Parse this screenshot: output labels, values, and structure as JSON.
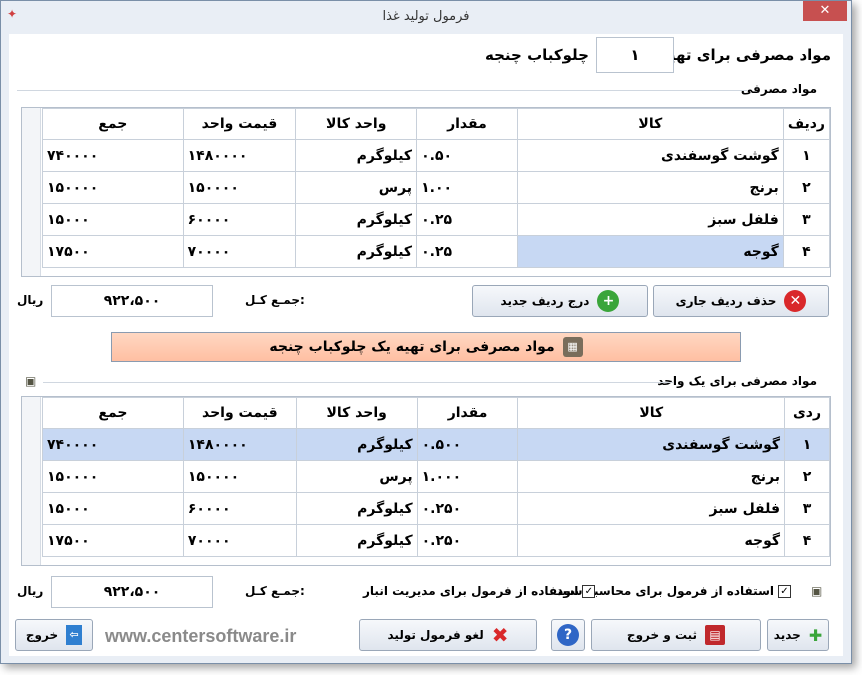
{
  "window": {
    "title": "فرمول تولید غذا",
    "close_label": "✕"
  },
  "header": {
    "label": "مواد مصرفی برای تهیه",
    "quantity": "۱",
    "product": "چلوکباب چنجه"
  },
  "section1": {
    "title": "مواد مصرفی",
    "columns": [
      "ردیف",
      "کالا",
      "مقدار",
      "واحد کالا",
      "قیمت واحد",
      "جمع"
    ],
    "rows": [
      {
        "idx": "۱",
        "item": "گوشت گوسفندی",
        "qty": "۰.۵۰",
        "unit": "کیلوگرم",
        "price": "۱۴۸۰۰۰۰",
        "total": "۷۴۰۰۰۰"
      },
      {
        "idx": "۲",
        "item": "برنج",
        "qty": "۱.۰۰",
        "unit": "پرس",
        "price": "۱۵۰۰۰۰",
        "total": "۱۵۰۰۰۰"
      },
      {
        "idx": "۳",
        "item": "فلفل سبز",
        "qty": "۰.۲۵",
        "unit": "کیلوگرم",
        "price": "۶۰۰۰۰",
        "total": "۱۵۰۰۰"
      },
      {
        "idx": "۴",
        "item": "گوجه",
        "qty": "۰.۲۵",
        "unit": "کیلوگرم",
        "price": "۷۰۰۰۰",
        "total": "۱۷۵۰۰"
      }
    ],
    "delete_button": "حذف ردیف جاری",
    "insert_button": "درج ردیف جدید",
    "total_label": "جمـع کـل:",
    "total_value": "۹۲۲،۵۰۰",
    "currency": "ریال"
  },
  "banner": {
    "text": "مواد مصرفی برای تهیه یک  چلوکباب چنجه"
  },
  "section2": {
    "title": "مواد مصرفی برای یک واحد",
    "columns": [
      "ردی",
      "کالا",
      "مقدار",
      "واحد کالا",
      "قیمت واحد",
      "جمع"
    ],
    "rows": [
      {
        "idx": "۱",
        "item": "گوشت گوسفندی",
        "qty": "۰.۵۰۰",
        "unit": "کیلوگرم",
        "price": "۱۴۸۰۰۰۰",
        "total": "۷۴۰۰۰۰"
      },
      {
        "idx": "۲",
        "item": "برنج",
        "qty": "۱.۰۰۰",
        "unit": "پرس",
        "price": "۱۵۰۰۰۰",
        "total": "۱۵۰۰۰۰"
      },
      {
        "idx": "۳",
        "item": "فلفل سبز",
        "qty": "۰.۲۵۰",
        "unit": "کیلوگرم",
        "price": "۶۰۰۰۰",
        "total": "۱۵۰۰۰"
      },
      {
        "idx": "۴",
        "item": "گوجه",
        "qty": "۰.۲۵۰",
        "unit": "کیلوگرم",
        "price": "۷۰۰۰۰",
        "total": "۱۷۵۰۰"
      }
    ],
    "chk_profit": "استفاده از فرمول برای محاسبه سود",
    "chk_inventory": "استفاده از فرمول برای مدیریت انبار",
    "total_label": "جمـع کـل:",
    "total_value": "۹۲۲،۵۰۰",
    "currency": "ریال"
  },
  "footer": {
    "new_label": "جدید",
    "save_exit_label": "ثبت و خروج",
    "help_label": "?",
    "cancel_label": "لغو فرمول تولید",
    "exit_label": "خروج",
    "watermark": "www.centersoftware.ir"
  },
  "colors": {
    "selected_row": "#c7d8f3",
    "delete": "#d9282a",
    "add": "#3aa53a",
    "banner": "#ffc8ae"
  }
}
